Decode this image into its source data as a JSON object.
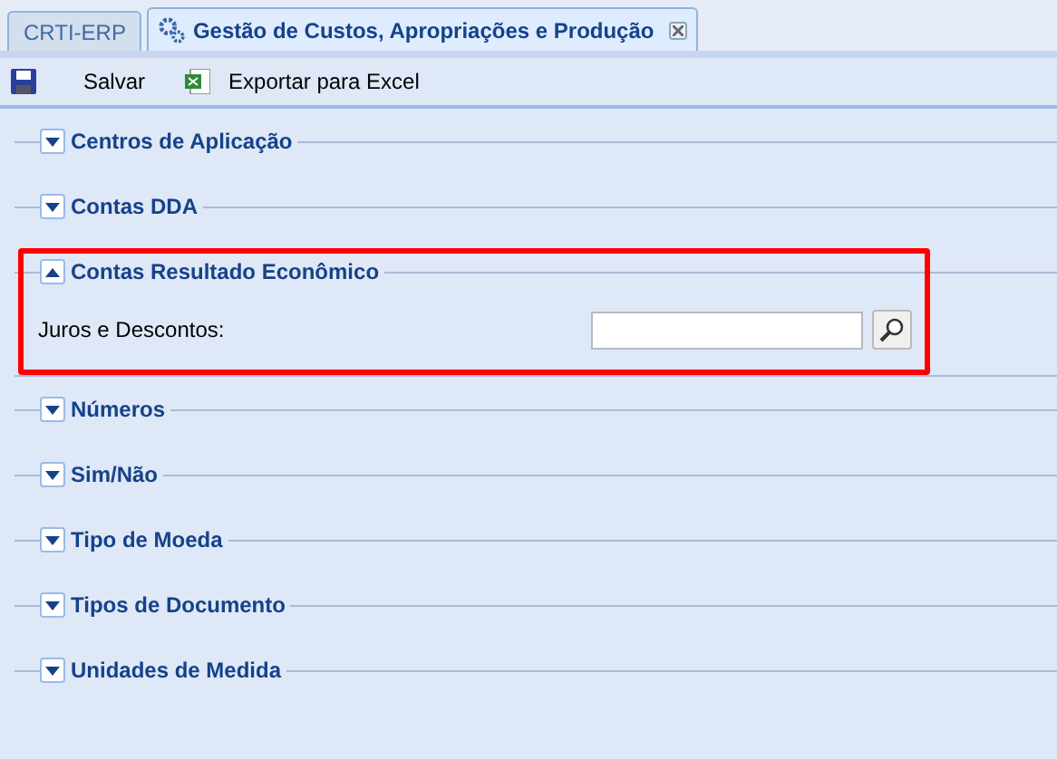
{
  "tabs": [
    {
      "label": "CRTI-ERP",
      "selected": false,
      "closable": false
    },
    {
      "label": "Gestão de Custos, Apropriações e Produção",
      "selected": true,
      "closable": true
    }
  ],
  "toolbar": [
    {
      "kind": "save",
      "label": "Salvar"
    },
    {
      "kind": "excel",
      "label": "Exportar para Excel"
    }
  ],
  "sections": [
    {
      "title": "Centros de Aplicação",
      "expanded": false,
      "highlighted": false
    },
    {
      "title": "Contas DDA",
      "expanded": false,
      "highlighted": false
    },
    {
      "title": "Contas Resultado Econômico",
      "expanded": true,
      "highlighted": true,
      "fields": [
        {
          "label": "Juros e Descontos:"
        }
      ]
    },
    {
      "title": "Números",
      "expanded": false,
      "highlighted": false
    },
    {
      "title": "Sim/Não",
      "expanded": false,
      "highlighted": false
    },
    {
      "title": "Tipo de Moeda",
      "expanded": false,
      "highlighted": false
    },
    {
      "title": "Tipos de Documento",
      "expanded": false,
      "highlighted": false
    },
    {
      "title": "Unidades de Medida",
      "expanded": false,
      "highlighted": false
    }
  ]
}
